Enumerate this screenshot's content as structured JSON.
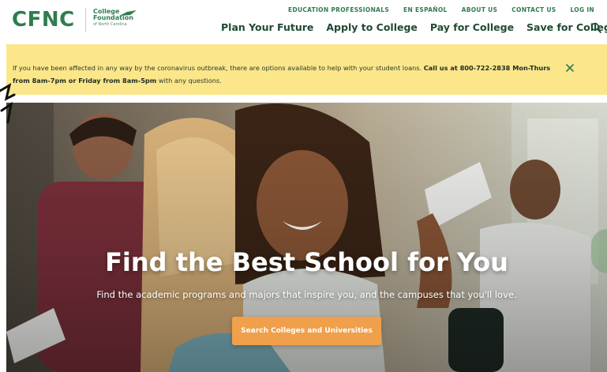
{
  "header": {
    "logo_text": "CFNC",
    "logo_secondary": {
      "line1": "College",
      "line2": "Foundation",
      "line3": "of North Carolina"
    },
    "utility_nav": [
      {
        "label": "EDUCATION PROFESSIONALS"
      },
      {
        "label": "EN ESPAÑOL"
      },
      {
        "label": "ABOUT US"
      },
      {
        "label": "CONTACT US"
      },
      {
        "label": "LOG IN"
      }
    ],
    "main_nav": [
      {
        "label": "Plan Your Future"
      },
      {
        "label": "Apply to College"
      },
      {
        "label": "Pay for College"
      },
      {
        "label": "Save for College"
      }
    ],
    "search_icon": "search-icon"
  },
  "alert": {
    "text_start": "If you have been affected in any way by the coronavirus outbreak, there are options available to help with your student loans.",
    "text_bold": "Call us at 800-722-2838 Mon-Thurs from 8am-7pm or Friday from 8am-5pm",
    "text_end": "with any questions.",
    "close_icon": "close-icon"
  },
  "hero": {
    "title": "Find the Best School for You",
    "subtitle": "Find the academic programs and majors that inspire you, and the campuses that you'll love.",
    "cta_label": "Search Colleges and Universities"
  },
  "colors": {
    "brand_green": "#2e7d4f",
    "nav_dark_green": "#1f4a33",
    "alert_yellow": "#fbe68a",
    "cta_orange": "#f0a04b"
  }
}
